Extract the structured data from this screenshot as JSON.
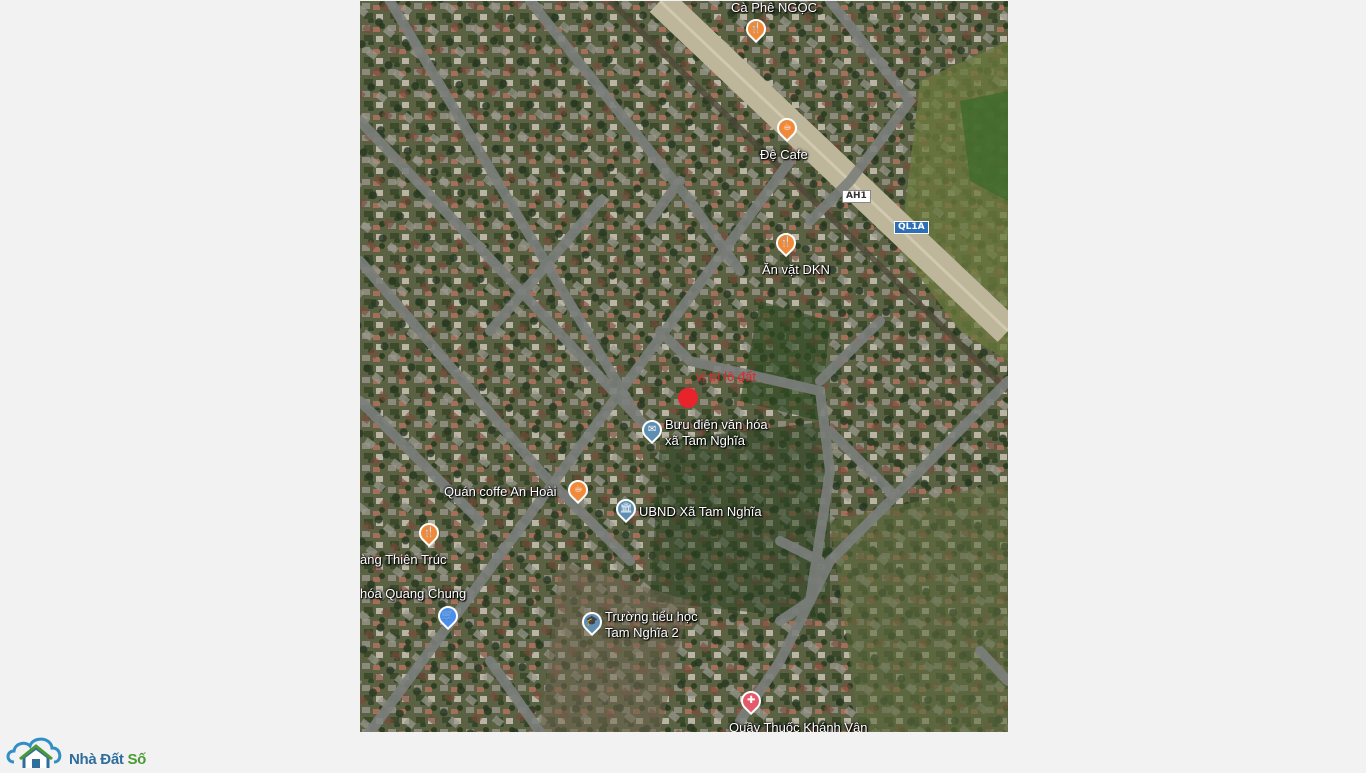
{
  "map": {
    "marker_label": "vị trí lô đất",
    "marker_color": "#e8232b",
    "pois": [
      {
        "id": "ca-phe-ngoc",
        "label": "Cà Phê NGỌC",
        "type": "restaurant",
        "color": "#f08a3a"
      },
      {
        "id": "de-cafe",
        "label": "Đệ Cafe",
        "type": "cafe",
        "color": "#f08a3a"
      },
      {
        "id": "an-vat-dkn",
        "label": "Ăn vặt DKN",
        "type": "restaurant",
        "color": "#f08a3a"
      },
      {
        "id": "buu-dien",
        "label": "Bưu điện văn hóa\nxã Tam Nghĩa",
        "type": "post",
        "color": "#5e8fb3"
      },
      {
        "id": "quan-coffe-an-hoai",
        "label": "Quán coffe An Hoài",
        "type": "cafe",
        "color": "#f08a3a"
      },
      {
        "id": "ubnd",
        "label": "UBND Xã Tam Nghĩa",
        "type": "government",
        "color": "#5e8fb3"
      },
      {
        "id": "thien-truc",
        "label": "àng Thiên Trúc",
        "type": "restaurant",
        "color": "#f08a3a"
      },
      {
        "id": "quang-chung",
        "label": "hóa Quang Chung",
        "type": "shopping",
        "color": "#4a8ef0"
      },
      {
        "id": "truong-tieu-hoc",
        "label": "Trường tiểu học\nTam Nghĩa 2",
        "type": "school",
        "color": "#5e8fb3"
      },
      {
        "id": "quay-thuoc",
        "label": "Quầy Thuốc Khánh Vân",
        "type": "pharmacy",
        "color": "#e45a6b"
      }
    ],
    "road_shields": [
      {
        "label": "AH1",
        "style": "white"
      },
      {
        "label": "QL1A",
        "style": "blue"
      }
    ]
  },
  "logo": {
    "brand_part1": "Nhà Đất ",
    "brand_part2": "Số"
  }
}
